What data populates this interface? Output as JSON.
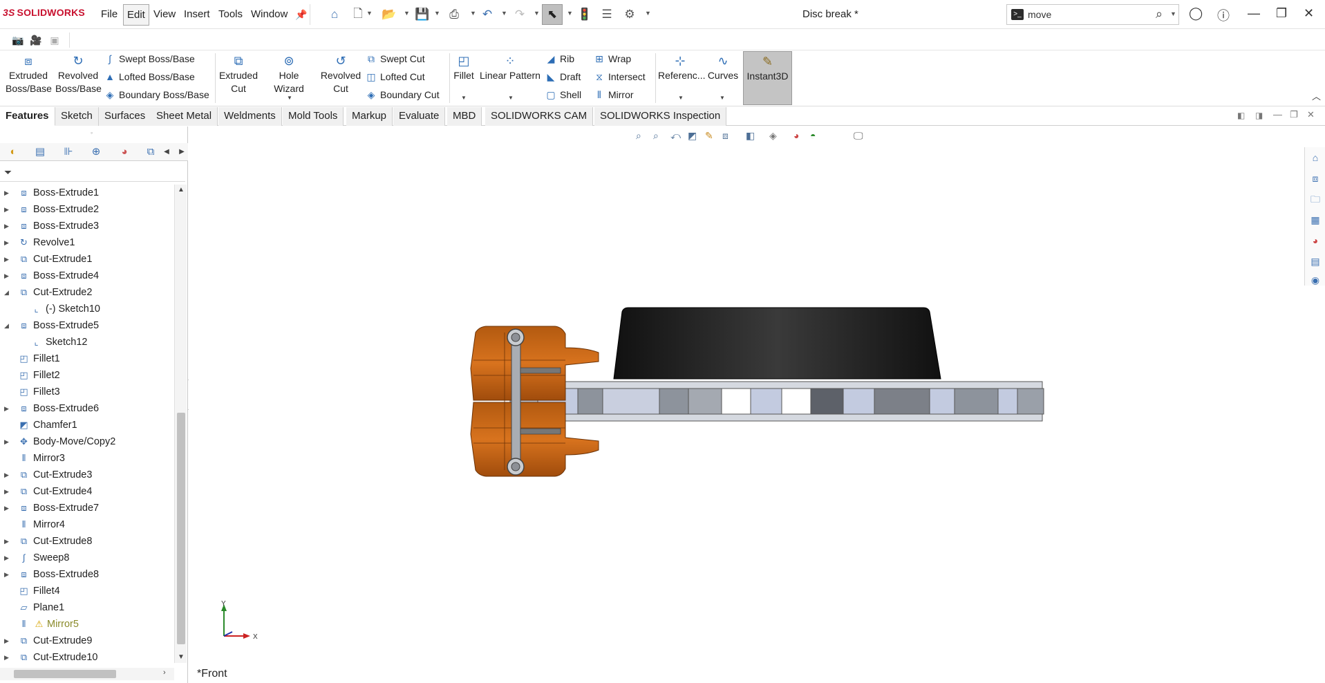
{
  "app": {
    "logo_ds": "3S",
    "logo_text": "SOLIDWORKS",
    "document_title": "Disc break *"
  },
  "menu": [
    "File",
    "Edit",
    "View",
    "Insert",
    "Tools",
    "Window"
  ],
  "search": {
    "value": "move",
    "cmd_glyph": ">_"
  },
  "ribbon": {
    "extruded_boss": [
      "Extruded",
      "Boss/Base"
    ],
    "revolved_boss": [
      "Revolved",
      "Boss/Base"
    ],
    "swept_boss": "Swept Boss/Base",
    "lofted_boss": "Lofted Boss/Base",
    "boundary_boss": "Boundary Boss/Base",
    "extruded_cut": [
      "Extruded",
      "Cut"
    ],
    "hole_wizard": "Hole Wizard",
    "revolved_cut": [
      "Revolved",
      "Cut"
    ],
    "swept_cut": "Swept Cut",
    "lofted_cut": "Lofted Cut",
    "boundary_cut": "Boundary Cut",
    "fillet": "Fillet",
    "linear_pattern": "Linear Pattern",
    "rib": "Rib",
    "draft": "Draft",
    "shell": "Shell",
    "wrap": "Wrap",
    "intersect": "Intersect",
    "mirror": "Mirror",
    "reference": "Referenc...",
    "curves": "Curves",
    "instant3d": "Instant3D"
  },
  "tabs": [
    "Features",
    "Sketch",
    "Surfaces",
    "Sheet Metal",
    "Weldments",
    "Mold Tools",
    "Markup",
    "Evaluate",
    "MBD",
    "SOLIDWORKS CAM",
    "SOLIDWORKS Inspection"
  ],
  "tree": [
    {
      "label": "Boss-Extrude1",
      "icon": "extrude-icon",
      "expandable": true
    },
    {
      "label": "Boss-Extrude2",
      "icon": "extrude-icon",
      "expandable": true
    },
    {
      "label": "Boss-Extrude3",
      "icon": "extrude-icon",
      "expandable": true
    },
    {
      "label": "Revolve1",
      "icon": "revolve-icon",
      "expandable": true
    },
    {
      "label": "Cut-Extrude1",
      "icon": "cut-extrude-icon",
      "expandable": true
    },
    {
      "label": "Boss-Extrude4",
      "icon": "extrude-icon",
      "expandable": true
    },
    {
      "label": "Cut-Extrude2",
      "icon": "cut-extrude-icon",
      "expandable": true,
      "expanded": true
    },
    {
      "label": "(-) Sketch10",
      "icon": "sketch-icon",
      "child": true
    },
    {
      "label": "Boss-Extrude5",
      "icon": "extrude-icon",
      "expandable": true,
      "expanded": true
    },
    {
      "label": "Sketch12",
      "icon": "sketch-icon",
      "child": true
    },
    {
      "label": "Fillet1",
      "icon": "fillet-icon"
    },
    {
      "label": "Fillet2",
      "icon": "fillet-icon"
    },
    {
      "label": "Fillet3",
      "icon": "fillet-icon"
    },
    {
      "label": "Boss-Extrude6",
      "icon": "extrude-icon",
      "expandable": true
    },
    {
      "label": "Chamfer1",
      "icon": "chamfer-icon"
    },
    {
      "label": "Body-Move/Copy2",
      "icon": "move-copy-icon",
      "expandable": true
    },
    {
      "label": "Mirror3",
      "icon": "mirror-icon"
    },
    {
      "label": "Cut-Extrude3",
      "icon": "cut-extrude-icon",
      "expandable": true
    },
    {
      "label": "Cut-Extrude4",
      "icon": "cut-extrude-icon",
      "expandable": true
    },
    {
      "label": "Boss-Extrude7",
      "icon": "extrude-icon",
      "expandable": true
    },
    {
      "label": "Mirror4",
      "icon": "mirror-icon"
    },
    {
      "label": "Cut-Extrude8",
      "icon": "cut-extrude-icon",
      "expandable": true
    },
    {
      "label": "Sweep8",
      "icon": "sweep-icon",
      "expandable": true
    },
    {
      "label": "Boss-Extrude8",
      "icon": "extrude-icon",
      "expandable": true
    },
    {
      "label": "Fillet4",
      "icon": "fillet-icon"
    },
    {
      "label": "Plane1",
      "icon": "plane-icon"
    },
    {
      "label": "Mirror5",
      "icon": "mirror-icon",
      "warning": true
    },
    {
      "label": "Cut-Extrude9",
      "icon": "cut-extrude-icon",
      "expandable": true
    },
    {
      "label": "Cut-Extrude10",
      "icon": "cut-extrude-icon",
      "expandable": true
    }
  ],
  "viewport": {
    "view_name": "*Front",
    "axis_y": "Y",
    "axis_x": "X"
  },
  "colors": {
    "accent": "#2d6db5",
    "caliper_orange": "#c8600f",
    "pad_black": "#1a1a1a",
    "disc_gray": "#b4bcc9"
  }
}
